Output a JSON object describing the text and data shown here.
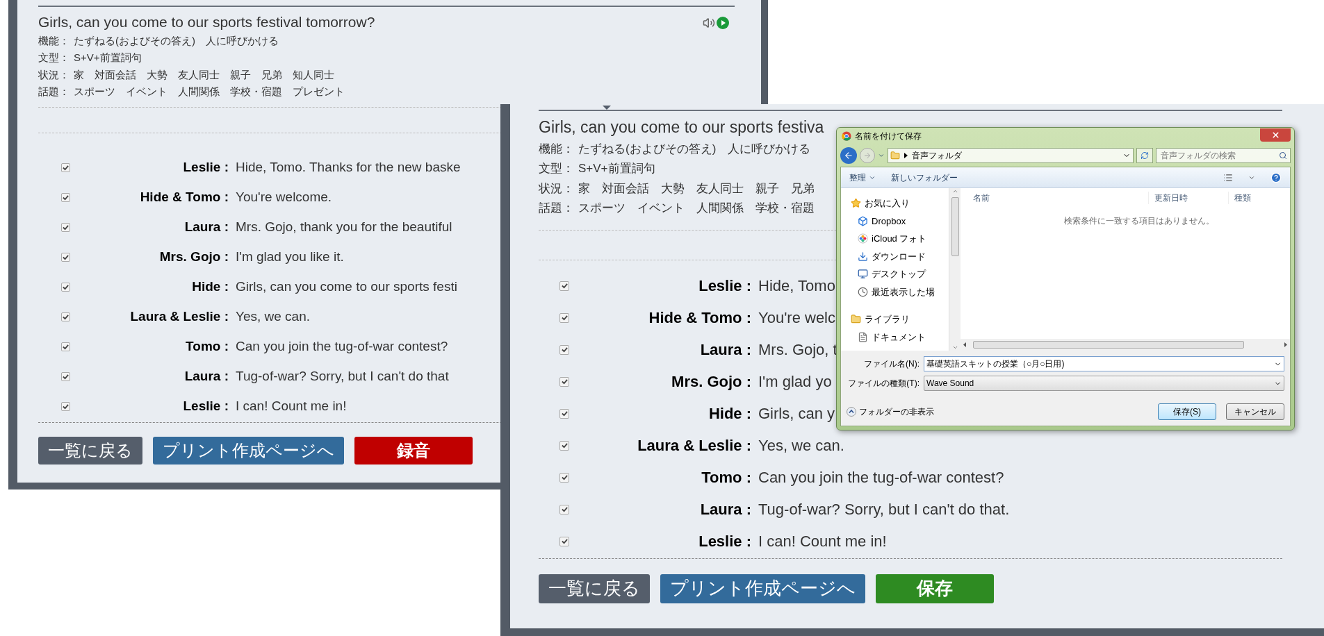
{
  "panels": [
    {
      "title": "Girls, can you come to our sports festival tomorrow?",
      "audio_icons": true,
      "info": [
        {
          "label": "機能：",
          "text": "たずねる(およびその答え)　人に呼びかける"
        },
        {
          "label": "文型：",
          "text": "S+V+前置詞句"
        },
        {
          "label": "状況：",
          "text": "家　対面会話　大勢　友人同士　親子　兄弟　知人同士"
        },
        {
          "label": "話題：",
          "text": "スポーツ　イベント　人間関係　学校・宿題　プレゼント"
        }
      ],
      "rows": [
        {
          "checked": true,
          "speaker": "Leslie :",
          "line": "Hide, Tomo. Thanks for the new baske"
        },
        {
          "checked": true,
          "speaker": "Hide & Tomo :",
          "line": "You're welcome."
        },
        {
          "checked": true,
          "speaker": "Laura :",
          "line": "Mrs. Gojo, thank you for the beautiful"
        },
        {
          "checked": true,
          "speaker": "Mrs. Gojo :",
          "line": "I'm glad you like it."
        },
        {
          "checked": true,
          "speaker": "Hide :",
          "line": "Girls, can you come to our sports festi"
        },
        {
          "checked": true,
          "speaker": "Laura & Leslie :",
          "line": "Yes, we can."
        },
        {
          "checked": true,
          "speaker": "Tomo :",
          "line": "Can you join the tug-of-war contest?"
        },
        {
          "checked": true,
          "speaker": "Laura :",
          "line": "Tug-of-war? Sorry, but I can't do that"
        },
        {
          "checked": true,
          "speaker": "Leslie :",
          "line": "I can! Count me in!"
        }
      ],
      "buttons": [
        {
          "kind": "back",
          "label": "一覧に戻る"
        },
        {
          "kind": "print",
          "label": "プリント作成ページへ"
        },
        {
          "kind": "record",
          "label": "録音"
        }
      ]
    },
    {
      "title": "Girls, can you come to our sports festiva",
      "audio_icons": false,
      "info": [
        {
          "label": "機能：",
          "text": "たずねる(およびその答え)　人に呼びかける"
        },
        {
          "label": "文型：",
          "text": "S+V+前置詞句"
        },
        {
          "label": "状況：",
          "text": "家　対面会話　大勢　友人同士　親子　兄弟"
        },
        {
          "label": "話題：",
          "text": "スポーツ　イベント　人間関係　学校・宿題"
        }
      ],
      "rows": [
        {
          "checked": true,
          "speaker": "Leslie :",
          "line": "Hide, Tomo"
        },
        {
          "checked": true,
          "speaker": "Hide & Tomo :",
          "line": "You're welc"
        },
        {
          "checked": true,
          "speaker": "Laura :",
          "line": "Mrs. Gojo, t"
        },
        {
          "checked": true,
          "speaker": "Mrs. Gojo :",
          "line": "I'm glad yo"
        },
        {
          "checked": true,
          "speaker": "Hide :",
          "line": "Girls, can y"
        },
        {
          "checked": true,
          "speaker": "Laura & Leslie :",
          "line": "Yes, we can."
        },
        {
          "checked": true,
          "speaker": "Tomo :",
          "line": "Can you join the tug-of-war contest?"
        },
        {
          "checked": true,
          "speaker": "Laura :",
          "line": "Tug-of-war? Sorry, but I can't do that."
        },
        {
          "checked": true,
          "speaker": "Leslie :",
          "line": "I can! Count me in!"
        }
      ],
      "buttons": [
        {
          "kind": "back",
          "label": "一覧に戻る"
        },
        {
          "kind": "print",
          "label": "プリント作成ページへ"
        },
        {
          "kind": "save",
          "label": "保存"
        }
      ]
    }
  ],
  "dialog": {
    "title": "名前を付けて保存",
    "path": "音声フォルダ",
    "search_placeholder": "音声フォルダの検索",
    "toolbar": [
      {
        "label": "整理",
        "dropdown": true
      },
      {
        "label": "新しいフォルダー",
        "dropdown": false
      }
    ],
    "nav": [
      {
        "kind": "star",
        "label": "お気に入り",
        "children": [
          {
            "kind": "dropbox",
            "label": "Dropbox"
          },
          {
            "kind": "photos",
            "label": "iCloud フォト"
          },
          {
            "kind": "download",
            "label": "ダウンロード"
          },
          {
            "kind": "desktop",
            "label": "デスクトップ"
          },
          {
            "kind": "recent",
            "label": "最近表示した場"
          }
        ]
      },
      {
        "kind": "library",
        "label": "ライブラリ",
        "children": [
          {
            "kind": "document",
            "label": "ドキュメント"
          }
        ]
      }
    ],
    "columns": [
      "名前",
      "更新日時",
      "種類"
    ],
    "empty_message": "検索条件に一致する項目はありません。",
    "filename": {
      "label": "ファイル名(N):",
      "value": "基礎英語スキットの授業（○月○日用)"
    },
    "filetype": {
      "label": "ファイルの種類(T):",
      "value": "Wave Sound"
    },
    "hide_folders": "フォルダーの非表示",
    "buttons": [
      {
        "label": "保存(S)",
        "default": true
      },
      {
        "label": "キャンセル",
        "default": false
      }
    ]
  }
}
